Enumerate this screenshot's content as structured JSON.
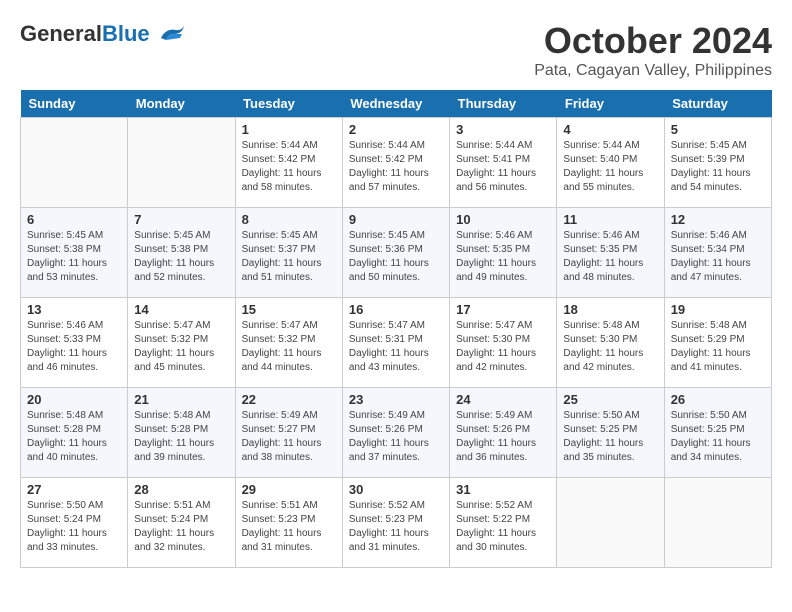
{
  "logo": {
    "general": "General",
    "blue": "Blue"
  },
  "title": "October 2024",
  "location": "Pata, Cagayan Valley, Philippines",
  "days_of_week": [
    "Sunday",
    "Monday",
    "Tuesday",
    "Wednesday",
    "Thursday",
    "Friday",
    "Saturday"
  ],
  "weeks": [
    [
      {
        "day": "",
        "info": ""
      },
      {
        "day": "",
        "info": ""
      },
      {
        "day": "1",
        "info": "Sunrise: 5:44 AM\nSunset: 5:42 PM\nDaylight: 11 hours and 58 minutes."
      },
      {
        "day": "2",
        "info": "Sunrise: 5:44 AM\nSunset: 5:42 PM\nDaylight: 11 hours and 57 minutes."
      },
      {
        "day": "3",
        "info": "Sunrise: 5:44 AM\nSunset: 5:41 PM\nDaylight: 11 hours and 56 minutes."
      },
      {
        "day": "4",
        "info": "Sunrise: 5:44 AM\nSunset: 5:40 PM\nDaylight: 11 hours and 55 minutes."
      },
      {
        "day": "5",
        "info": "Sunrise: 5:45 AM\nSunset: 5:39 PM\nDaylight: 11 hours and 54 minutes."
      }
    ],
    [
      {
        "day": "6",
        "info": "Sunrise: 5:45 AM\nSunset: 5:38 PM\nDaylight: 11 hours and 53 minutes."
      },
      {
        "day": "7",
        "info": "Sunrise: 5:45 AM\nSunset: 5:38 PM\nDaylight: 11 hours and 52 minutes."
      },
      {
        "day": "8",
        "info": "Sunrise: 5:45 AM\nSunset: 5:37 PM\nDaylight: 11 hours and 51 minutes."
      },
      {
        "day": "9",
        "info": "Sunrise: 5:45 AM\nSunset: 5:36 PM\nDaylight: 11 hours and 50 minutes."
      },
      {
        "day": "10",
        "info": "Sunrise: 5:46 AM\nSunset: 5:35 PM\nDaylight: 11 hours and 49 minutes."
      },
      {
        "day": "11",
        "info": "Sunrise: 5:46 AM\nSunset: 5:35 PM\nDaylight: 11 hours and 48 minutes."
      },
      {
        "day": "12",
        "info": "Sunrise: 5:46 AM\nSunset: 5:34 PM\nDaylight: 11 hours and 47 minutes."
      }
    ],
    [
      {
        "day": "13",
        "info": "Sunrise: 5:46 AM\nSunset: 5:33 PM\nDaylight: 11 hours and 46 minutes."
      },
      {
        "day": "14",
        "info": "Sunrise: 5:47 AM\nSunset: 5:32 PM\nDaylight: 11 hours and 45 minutes."
      },
      {
        "day": "15",
        "info": "Sunrise: 5:47 AM\nSunset: 5:32 PM\nDaylight: 11 hours and 44 minutes."
      },
      {
        "day": "16",
        "info": "Sunrise: 5:47 AM\nSunset: 5:31 PM\nDaylight: 11 hours and 43 minutes."
      },
      {
        "day": "17",
        "info": "Sunrise: 5:47 AM\nSunset: 5:30 PM\nDaylight: 11 hours and 42 minutes."
      },
      {
        "day": "18",
        "info": "Sunrise: 5:48 AM\nSunset: 5:30 PM\nDaylight: 11 hours and 42 minutes."
      },
      {
        "day": "19",
        "info": "Sunrise: 5:48 AM\nSunset: 5:29 PM\nDaylight: 11 hours and 41 minutes."
      }
    ],
    [
      {
        "day": "20",
        "info": "Sunrise: 5:48 AM\nSunset: 5:28 PM\nDaylight: 11 hours and 40 minutes."
      },
      {
        "day": "21",
        "info": "Sunrise: 5:48 AM\nSunset: 5:28 PM\nDaylight: 11 hours and 39 minutes."
      },
      {
        "day": "22",
        "info": "Sunrise: 5:49 AM\nSunset: 5:27 PM\nDaylight: 11 hours and 38 minutes."
      },
      {
        "day": "23",
        "info": "Sunrise: 5:49 AM\nSunset: 5:26 PM\nDaylight: 11 hours and 37 minutes."
      },
      {
        "day": "24",
        "info": "Sunrise: 5:49 AM\nSunset: 5:26 PM\nDaylight: 11 hours and 36 minutes."
      },
      {
        "day": "25",
        "info": "Sunrise: 5:50 AM\nSunset: 5:25 PM\nDaylight: 11 hours and 35 minutes."
      },
      {
        "day": "26",
        "info": "Sunrise: 5:50 AM\nSunset: 5:25 PM\nDaylight: 11 hours and 34 minutes."
      }
    ],
    [
      {
        "day": "27",
        "info": "Sunrise: 5:50 AM\nSunset: 5:24 PM\nDaylight: 11 hours and 33 minutes."
      },
      {
        "day": "28",
        "info": "Sunrise: 5:51 AM\nSunset: 5:24 PM\nDaylight: 11 hours and 32 minutes."
      },
      {
        "day": "29",
        "info": "Sunrise: 5:51 AM\nSunset: 5:23 PM\nDaylight: 11 hours and 31 minutes."
      },
      {
        "day": "30",
        "info": "Sunrise: 5:52 AM\nSunset: 5:23 PM\nDaylight: 11 hours and 31 minutes."
      },
      {
        "day": "31",
        "info": "Sunrise: 5:52 AM\nSunset: 5:22 PM\nDaylight: 11 hours and 30 minutes."
      },
      {
        "day": "",
        "info": ""
      },
      {
        "day": "",
        "info": ""
      }
    ]
  ]
}
